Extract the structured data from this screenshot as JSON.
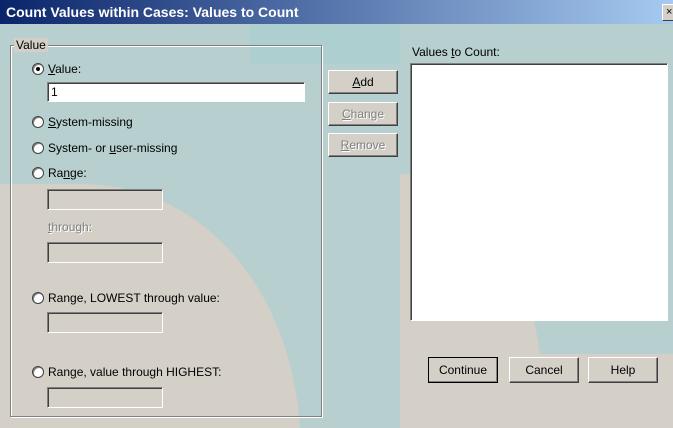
{
  "window": {
    "title": "Count Values within Cases: Values to Count",
    "close_glyph": "×"
  },
  "value_group": {
    "legend": "Value"
  },
  "options": {
    "value": {
      "pre": "",
      "key": "V",
      "post": "alue:",
      "selected": true,
      "input_value": "1"
    },
    "system_missing": {
      "pre": "",
      "key": "S",
      "post": "ystem-missing",
      "selected": false
    },
    "system_or_user": {
      "pre": "System- or ",
      "key": "u",
      "post": "ser-missing",
      "selected": false
    },
    "range": {
      "pre": "Ra",
      "key": "n",
      "post": "ge:",
      "selected": false,
      "through_pre": "",
      "through_key": "t",
      "through_post": "hrough:"
    },
    "range_lowest": {
      "pre": "Range, LOWEST through value:",
      "key": "",
      "post": "",
      "selected": false
    },
    "range_highest": {
      "pre": "Ran",
      "key": "g",
      "post": "e, value through HIGHEST:",
      "selected": false
    }
  },
  "list": {
    "pre": "Values ",
    "key": "t",
    "post": "o Count:"
  },
  "buttons": {
    "add": {
      "key": "A",
      "post": "dd"
    },
    "change": {
      "key": "C",
      "post": "hange"
    },
    "remove": {
      "key": "R",
      "post": "emove"
    },
    "continue": "Continue",
    "cancel": "Cancel",
    "help": "Help"
  },
  "colors": {
    "title_start": "#0a246a",
    "title_end": "#a6caf0",
    "face": "#d4d0c8",
    "watermark": "#9ecdd3"
  }
}
